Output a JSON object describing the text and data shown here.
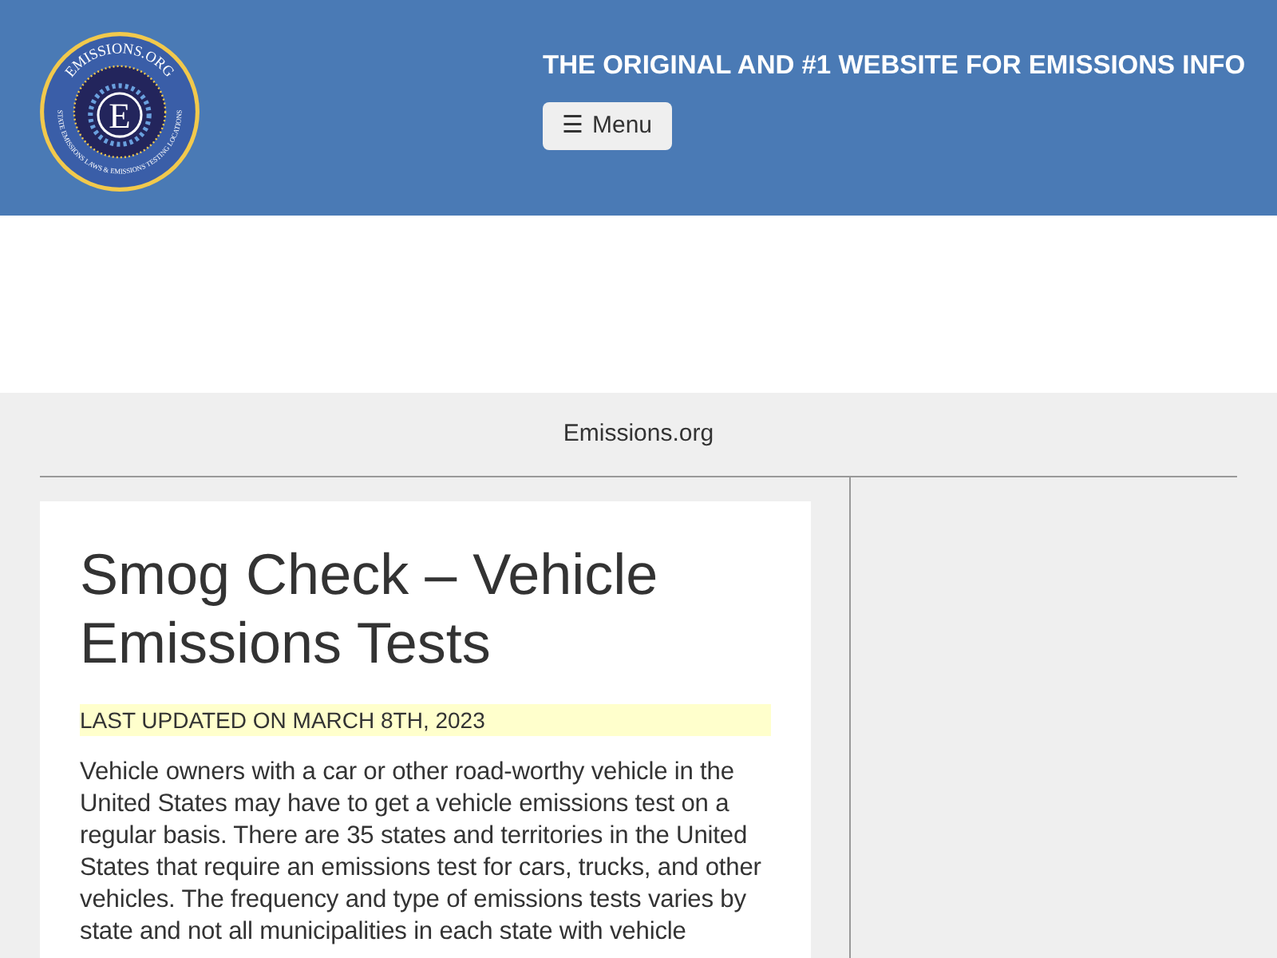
{
  "header": {
    "logo": {
      "top_text": "EMISSIONS.ORG",
      "ring_text": "STATE EMISSIONS LAWS & EMISSIONS TESTING LOCATIONS",
      "letter": "E"
    },
    "tagline": "THE ORIGINAL AND #1 WEBSITE FOR EMISSIONS INFO",
    "menu_button": {
      "icon": "☰",
      "label": "Menu"
    }
  },
  "breadcrumb": "Emissions.org",
  "article": {
    "title": "Smog Check – Vehicle Emissions Tests",
    "updated": "LAST UPDATED ON MARCH 8TH, 2023",
    "paragraph": "Vehicle owners with a car or other road-worthy vehicle in the United States may have to get a vehicle emissions test on a regular basis. There are 35 states and territories in the United States that require an emissions test for cars, trucks, and other vehicles. The frequency and type of emissions tests varies by state and not all municipalities in each state with vehicle"
  }
}
